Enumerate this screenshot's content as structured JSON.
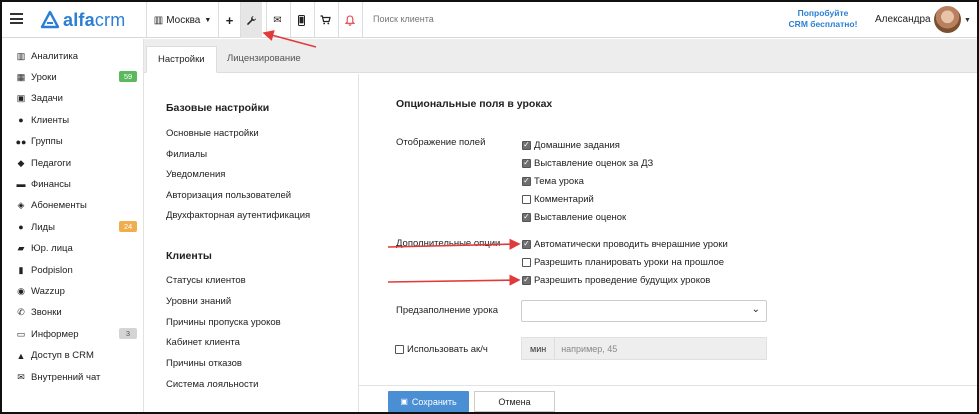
{
  "app": {
    "logo_text_bold": "alfa",
    "logo_text_rest": "crm",
    "branch": "Москва",
    "search_placeholder": "Поиск клиента",
    "promo_line1": "Попробуйте",
    "promo_line2": "CRM бесплатно!",
    "user_name": "Александра"
  },
  "sidebar": {
    "items": [
      {
        "label": "Аналитика",
        "icon": "chart-icon",
        "glyph": "▥"
      },
      {
        "label": "Уроки",
        "icon": "calendar-icon",
        "glyph": "▦",
        "badge": "59",
        "badge_color": "#5cb85c"
      },
      {
        "label": "Задачи",
        "icon": "clipboard-icon",
        "glyph": "▣"
      },
      {
        "label": "Клиенты",
        "icon": "user-icon",
        "glyph": "●"
      },
      {
        "label": "Группы",
        "icon": "users-icon",
        "glyph": "●●"
      },
      {
        "label": "Педагоги",
        "icon": "graduation-cap-icon",
        "glyph": "◆"
      },
      {
        "label": "Финансы",
        "icon": "money-icon",
        "glyph": "▬"
      },
      {
        "label": "Абонементы",
        "icon": "tag-icon",
        "glyph": "◈"
      },
      {
        "label": "Лиды",
        "icon": "user-plus-icon",
        "glyph": "●",
        "badge": "24",
        "badge_color": "#f0ad4e"
      },
      {
        "label": "Юр. лица",
        "icon": "briefcase-icon",
        "glyph": "▰"
      },
      {
        "label": "Podpislon",
        "icon": "file-icon",
        "glyph": "▮"
      },
      {
        "label": "Wazzup",
        "icon": "whatsapp-icon",
        "glyph": "◉"
      },
      {
        "label": "Звонки",
        "icon": "phone-icon",
        "glyph": "✆"
      },
      {
        "label": "Информер",
        "icon": "inbox-icon",
        "glyph": "▭",
        "badge": "3",
        "badge_color": "#d4d4d4"
      },
      {
        "label": "Доступ в CRM",
        "icon": "lock-icon",
        "glyph": "▲"
      },
      {
        "label": "Внутренний чат",
        "icon": "envelope-icon",
        "glyph": "✉"
      }
    ]
  },
  "tabs": [
    {
      "label": "Настройки",
      "active": true
    },
    {
      "label": "Лицензирование",
      "active": false
    }
  ],
  "nav": {
    "basic_header": "Базовые настройки",
    "basic_links": [
      "Основные настройки",
      "Филиалы",
      "Уведомления",
      "Авторизация пользователей",
      "Двухфакторная аутентификация"
    ],
    "clients_header": "Клиенты",
    "clients_links": [
      "Статусы клиентов",
      "Уровни знаний",
      "Причины пропуска уроков",
      "Кабинет клиента",
      "Причины отказов",
      "Система лояльности"
    ]
  },
  "content": {
    "title": "Опциональные поля в уроках",
    "display_label": "Отображение полей",
    "display_options": [
      {
        "label": "Домашние задания",
        "checked": true
      },
      {
        "label": "Выставление оценок за ДЗ",
        "checked": true
      },
      {
        "label": "Тема урока",
        "checked": true
      },
      {
        "label": "Комментарий",
        "checked": false
      },
      {
        "label": "Выставление оценок",
        "checked": true
      }
    ],
    "extra_label": "Дополнительные опции",
    "extra_options": [
      {
        "label": "Автоматически проводить вчерашние уроки",
        "checked": true
      },
      {
        "label": "Разрешить планировать уроки на прошлое",
        "checked": false
      },
      {
        "label": "Разрешить проведение будущих уроков",
        "checked": true
      }
    ],
    "prefill_label": "Предзаполнение урока",
    "prefill_value": "",
    "akch_label": "Использовать ак/ч",
    "akch_checked": false,
    "min_unit": "мин",
    "min_placeholder": "например, 45",
    "save_label": "Сохранить",
    "cancel_label": "Отмена"
  },
  "colors": {
    "brand": "#2a7fd4",
    "primary_button": "#4a8fd4",
    "annotation_arrow": "#e03a3a"
  }
}
